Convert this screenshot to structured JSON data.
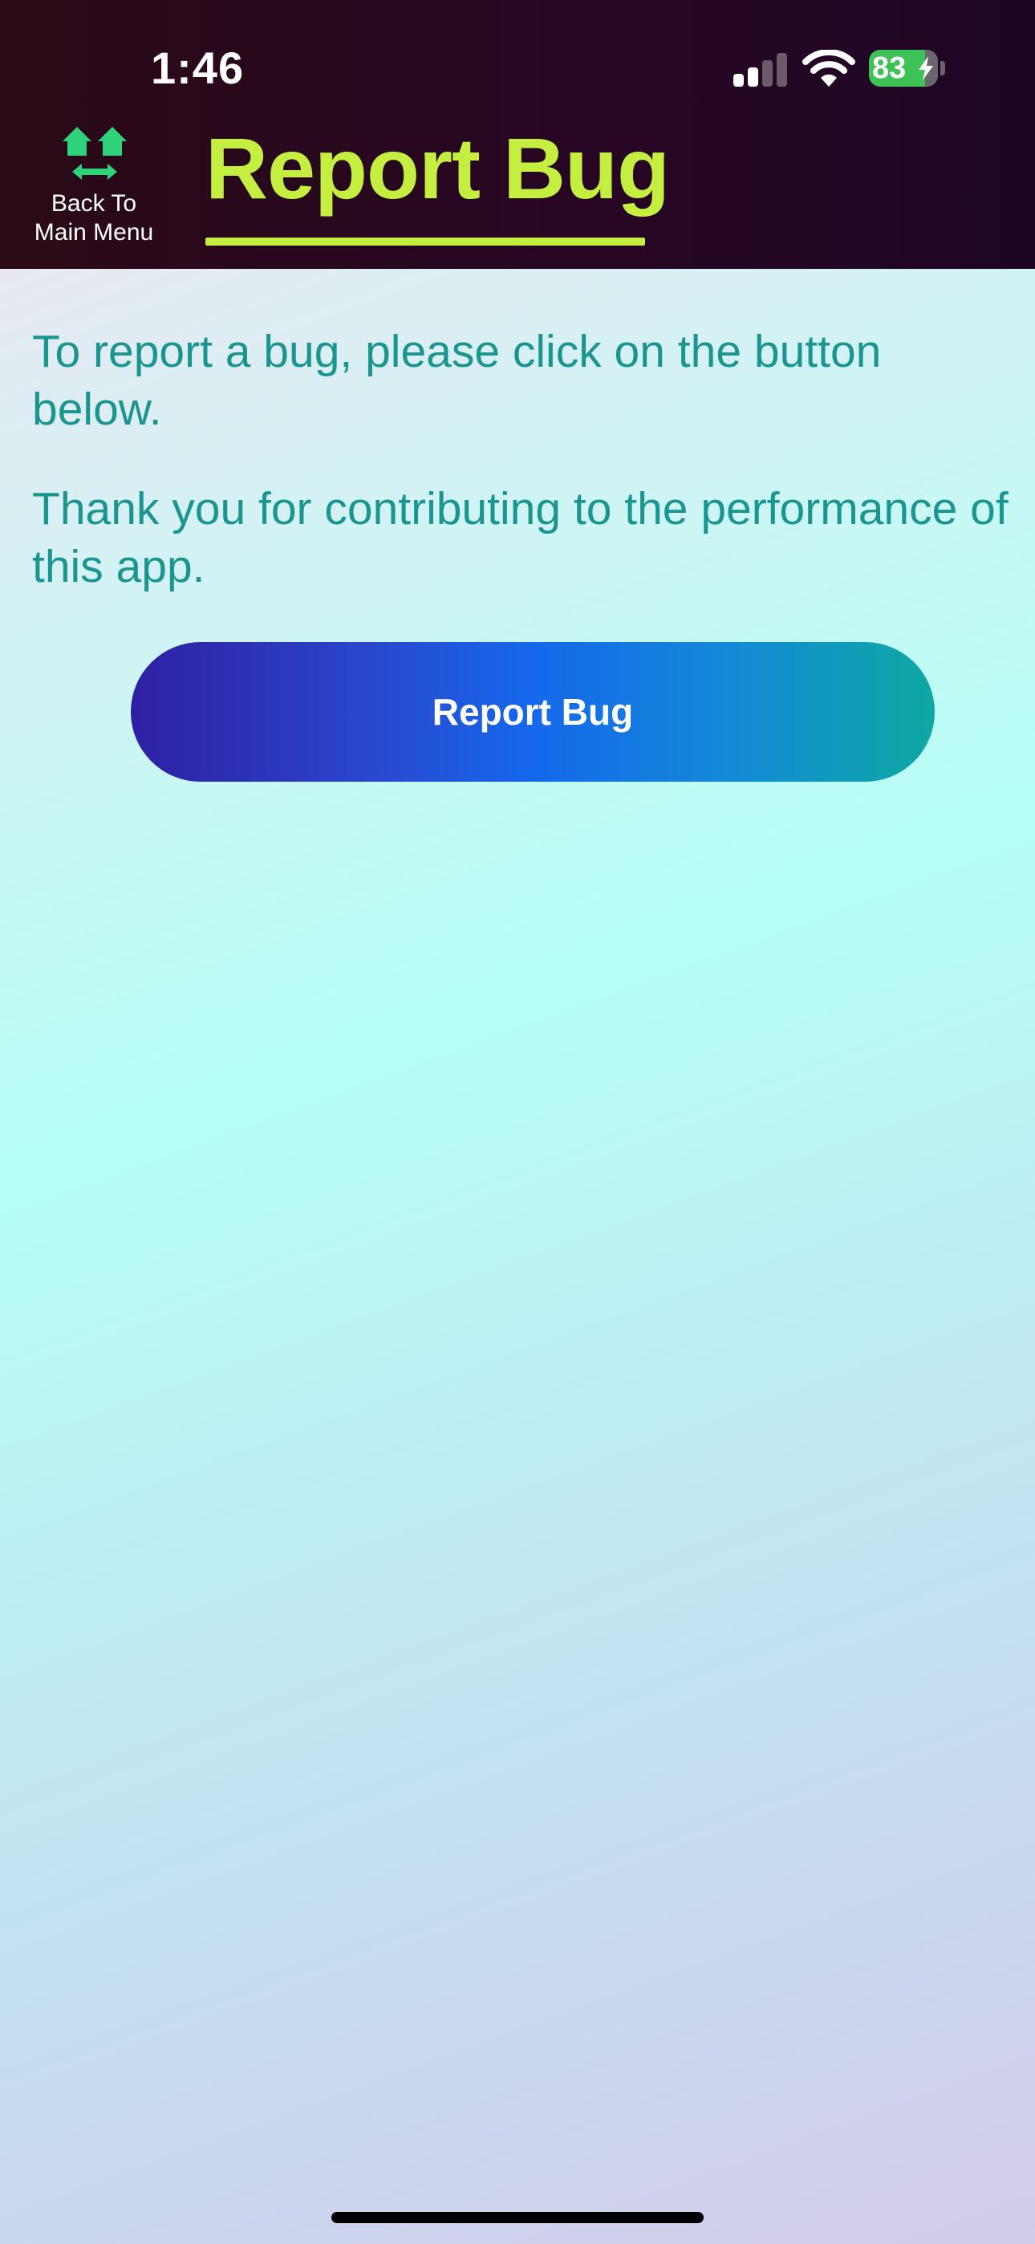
{
  "status_bar": {
    "time": "1:46",
    "battery_percent": "83",
    "signal_bars": 2,
    "signal_bars_total": 4,
    "wifi_icon": "wifi-icon",
    "charging_icon": "bolt-icon"
  },
  "header": {
    "back_button": {
      "icon": "home-exchange-icon",
      "label_line1": "Back To",
      "label_line2": "Main Menu"
    },
    "title": "Report Bug"
  },
  "main": {
    "paragraph_1": "To report a bug, please click on the button below.",
    "paragraph_2": "Thank you for contributing to the performance of this app.",
    "report_button_label": "Report Bug"
  },
  "colors": {
    "header_bg": "#260623",
    "title_accent": "#c4ef40",
    "back_icon": "#2fd47a",
    "body_text": "#1b9590",
    "button_gradient_start": "#2e1fa2",
    "button_gradient_mid": "#1568ec",
    "button_gradient_end": "#0ea8a0"
  }
}
